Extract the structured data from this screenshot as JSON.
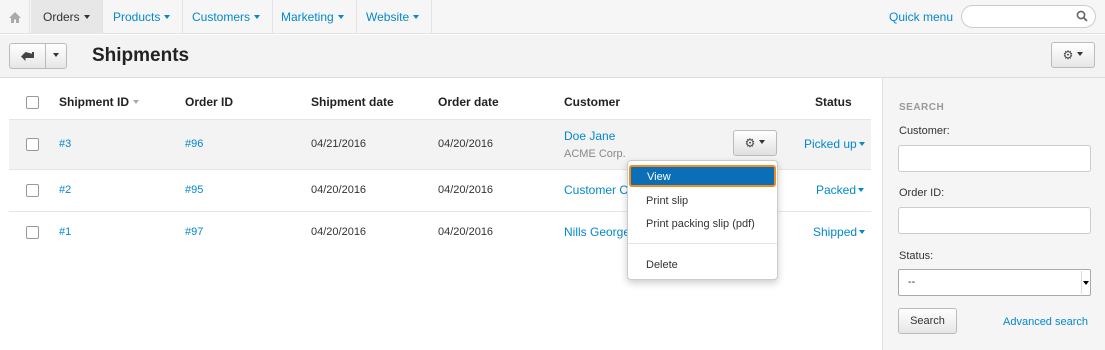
{
  "topnav": {
    "items": [
      {
        "label": "Orders",
        "active": true
      },
      {
        "label": "Products",
        "active": false
      },
      {
        "label": "Customers",
        "active": false
      },
      {
        "label": "Marketing",
        "active": false
      },
      {
        "label": "Website",
        "active": false
      }
    ],
    "quick_menu": "Quick menu",
    "search_value": ""
  },
  "header": {
    "title": "Shipments"
  },
  "table": {
    "columns": [
      "Shipment ID",
      "Order ID",
      "Shipment date",
      "Order date",
      "Customer",
      "Status"
    ],
    "rows": [
      {
        "shipment_id": "#3",
        "order_id": "#96",
        "shipment_date": "04/21/2016",
        "order_date": "04/20/2016",
        "customer": "Doe Jane",
        "company": "ACME Corp.",
        "status": "Picked up"
      },
      {
        "shipment_id": "#2",
        "order_id": "#95",
        "shipment_date": "04/20/2016",
        "order_date": "04/20/2016",
        "customer": "Customer Cu",
        "company": "",
        "status": "Packed"
      },
      {
        "shipment_id": "#1",
        "order_id": "#97",
        "shipment_date": "04/20/2016",
        "order_date": "04/20/2016",
        "customer": "Nills George",
        "company": "",
        "status": "Shipped"
      }
    ]
  },
  "dropdown": {
    "items": [
      "View",
      "Print slip",
      "Print packing slip (pdf)",
      "Delete"
    ]
  },
  "sidebar": {
    "title": "SEARCH",
    "customer_label": "Customer:",
    "order_id_label": "Order ID:",
    "status_label": "Status:",
    "status_value": "--",
    "search_button": "Search",
    "advanced_link": "Advanced search"
  },
  "colors": {
    "link": "#0388cc",
    "highlight": "#0a6fb7",
    "focus_ring": "#f28b23"
  }
}
